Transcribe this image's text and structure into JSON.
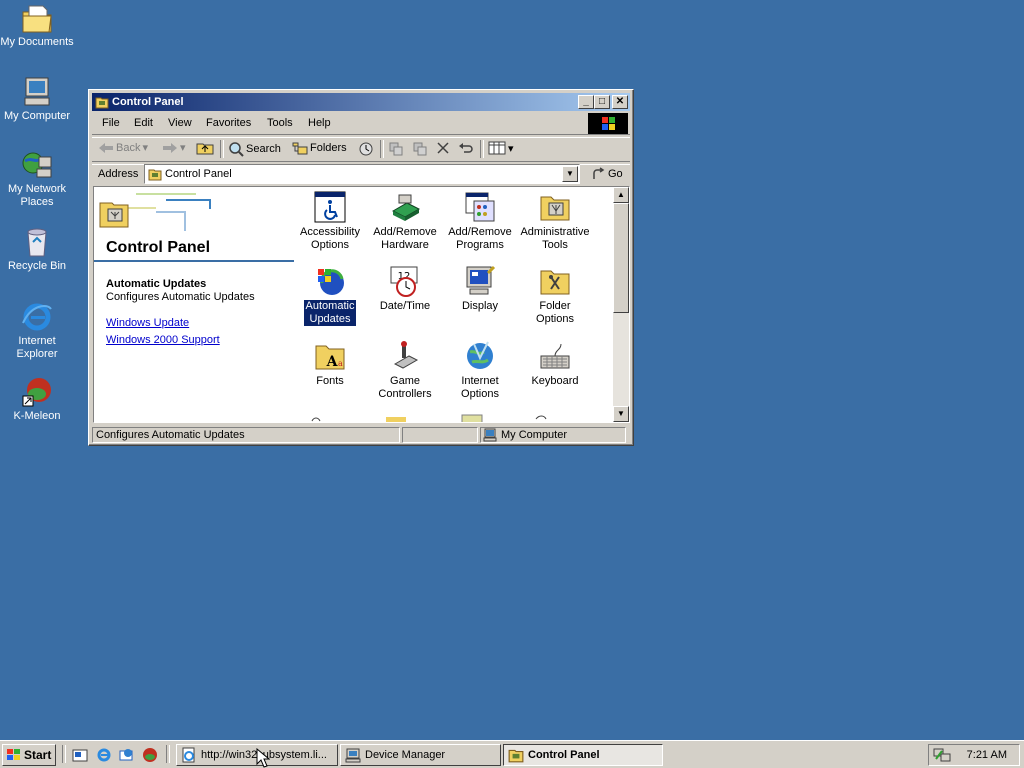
{
  "desktop": {
    "icons": [
      {
        "label": "My Documents",
        "icon": "my-documents-icon"
      },
      {
        "label": "My Computer",
        "icon": "my-computer-icon"
      },
      {
        "label": "My Network Places",
        "icon": "network-icon"
      },
      {
        "label": "Recycle Bin",
        "icon": "recycle-bin-icon"
      },
      {
        "label": "Internet Explorer",
        "icon": "ie-icon"
      },
      {
        "label": "K-Meleon",
        "icon": "kmeleon-icon"
      }
    ]
  },
  "window": {
    "title": "Control Panel",
    "menu": [
      "File",
      "Edit",
      "View",
      "Favorites",
      "Tools",
      "Help"
    ],
    "toolbar": {
      "back": "Back",
      "search": "Search",
      "folders": "Folders"
    },
    "address_label": "Address",
    "address_value": "Control Panel",
    "go_label": "Go",
    "left_pane": {
      "title": "Control Panel",
      "selected_title": "Automatic Updates",
      "selected_desc": "Configures Automatic Updates",
      "links": [
        "Windows Update",
        "Windows 2000 Support"
      ]
    },
    "items": [
      {
        "label": "Accessibility Options",
        "l1": "Accessibility",
        "l2": "Options"
      },
      {
        "label": "Add/Remove Hardware",
        "l1": "Add/Remove",
        "l2": "Hardware"
      },
      {
        "label": "Add/Remove Programs",
        "l1": "Add/Remove",
        "l2": "Programs"
      },
      {
        "label": "Administrative Tools",
        "l1": "Administrative",
        "l2": "Tools"
      },
      {
        "label": "Automatic Updates",
        "l1": "Automatic",
        "l2": "Updates"
      },
      {
        "label": "Date/Time",
        "l1": "Date/Time",
        "l2": ""
      },
      {
        "label": "Display",
        "l1": "Display",
        "l2": ""
      },
      {
        "label": "Folder Options",
        "l1": "Folder Options",
        "l2": ""
      },
      {
        "label": "Fonts",
        "l1": "Fonts",
        "l2": ""
      },
      {
        "label": "Game Controllers",
        "l1": "Game",
        "l2": "Controllers"
      },
      {
        "label": "Internet Options",
        "l1": "Internet",
        "l2": "Options"
      },
      {
        "label": "Keyboard",
        "l1": "Keyboard",
        "l2": ""
      }
    ],
    "status": {
      "left": "Configures Automatic Updates",
      "right": "My Computer"
    }
  },
  "taskbar": {
    "start": "Start",
    "buttons": [
      {
        "label": "http://win32subsystem.li..."
      },
      {
        "label": "Device Manager"
      },
      {
        "label": "Control Panel"
      }
    ],
    "clock": "7:21 AM"
  },
  "colors": {
    "desktop": "#3a6ea5",
    "titlebar_start": "#0a246a",
    "titlebar_end": "#a6caf0",
    "link": "#0000cc"
  }
}
